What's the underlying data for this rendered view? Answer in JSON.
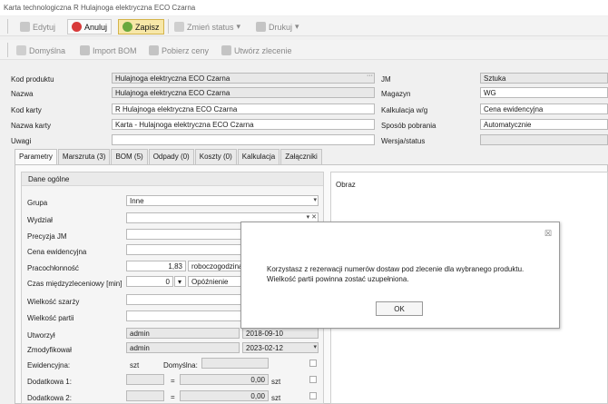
{
  "window": {
    "title": "Karta technologiczna R Hulajnoga elektryczna ECO Czarna"
  },
  "toolbar1": {
    "edit": "Edytuj",
    "cancel": "Anuluj",
    "save": "Zapisz",
    "change_status": "Zmień status",
    "print": "Drukuj"
  },
  "toolbar2": {
    "default": "Domyślna",
    "import_bom": "Import BOM",
    "get_prices": "Pobierz ceny",
    "create_order": "Utwórz zlecenie"
  },
  "header": {
    "product_code_label": "Kod produktu",
    "product_code": "Hulajnoga elektryczna ECO Czarna",
    "name_label": "Nazwa",
    "name": "Hulajnoga elektryczna ECO Czarna",
    "card_code_label": "Kod karty",
    "card_code": "R Hulajnoga elektryczna ECO Czarna",
    "card_name_label": "Nazwa karty",
    "card_name": "Karta - Hulajnoga elektryczna ECO Czarna",
    "notes_label": "Uwagi",
    "notes": "",
    "jm_label": "JM",
    "jm": "Sztuka",
    "warehouse_label": "Magazyn",
    "warehouse": "WG",
    "calc_label": "Kalkulacja w/g",
    "calc": "Cena ewidencyjna",
    "collection_label": "Sposób pobrania",
    "collection": "Automatycznie",
    "version_label": "Wersja/status",
    "version": "",
    "ellipsis": "···"
  },
  "tabs": [
    "Parametry",
    "Marszruta (3)",
    "BOM (5)",
    "Odpady (0)",
    "Koszty (0)",
    "Kalkulacja",
    "Załączniki"
  ],
  "general": {
    "title": "Dane ogólne",
    "group_label": "Grupa",
    "group": "Inne",
    "dept_label": "Wydział",
    "dept": "",
    "precision_label": "Precyzja JM",
    "price_label": "Cena ewidencyjna",
    "labor_label": "Pracochłonność",
    "labor": "1,83",
    "labor_unit": "roboczogodzina",
    "interop_label": "Czas międzyzleceniowy [min]",
    "interop": "0",
    "delay": "Opóźnienie",
    "batch_size_label": "Wielkość szarży",
    "lot_size_label": "Wielkość partii",
    "created_label": "Utworzył",
    "created_by": "admin",
    "created_date": "2018-09-10",
    "modified_label": "Zmodyfikował",
    "modified_by": "admin",
    "modified_date": "2023-02-12",
    "registry_label": "Ewidencyjna:",
    "registry_unit": "szt",
    "default_label": "Domyślna:",
    "extra1_label": "Dodatkowa 1:",
    "extra1_value": "0,00",
    "extra1_unit": "szt",
    "extra2_label": "Dodatkowa 2:",
    "extra2_value": "0,00",
    "extra2_unit": "szt",
    "eq": "="
  },
  "image_panel": {
    "title": "Obraz"
  },
  "dialog": {
    "message": "Korzystasz z rezerwacji numerów dostaw pod zlecenie dla wybranego produktu. Wielkość partii powinna zostać uzupełniona.",
    "ok": "OK",
    "close": "☒"
  }
}
